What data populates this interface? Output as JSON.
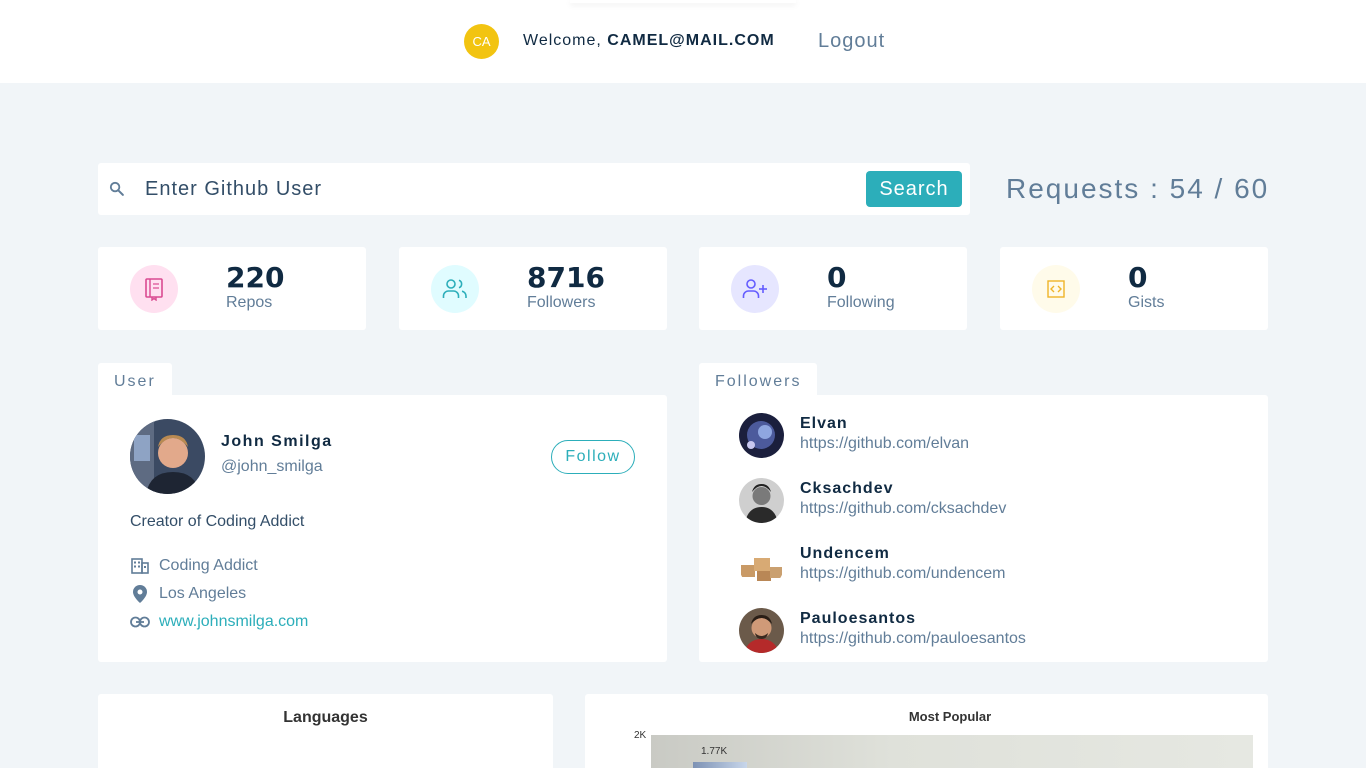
{
  "navbar": {
    "avatar_initials": "CA",
    "welcome_prefix": "Welcome,",
    "user_email": "CAMEL@MAIL.COM",
    "logout_label": "Logout",
    "avatar_color": "#f2c411"
  },
  "search": {
    "placeholder": "Enter Github User",
    "button_label": "Search",
    "requests_text": "Requests : 54 / 60"
  },
  "stats": [
    {
      "icon": "repo-book-icon",
      "value": "220",
      "label": "Repos",
      "color": "#da4a91",
      "bg": "#ffe0f0"
    },
    {
      "icon": "users-icon",
      "value": "8716",
      "label": "Followers",
      "color": "#2caeba",
      "bg": "#e0fcff"
    },
    {
      "icon": "user-plus-icon",
      "value": "0",
      "label": "Following",
      "color": "#645cff",
      "bg": "#e6e6ff"
    },
    {
      "icon": "code-icon",
      "value": "0",
      "label": "Gists",
      "color": "#f0b429",
      "bg": "#fffbea"
    }
  ],
  "user_card": {
    "tab_label": "User",
    "name": "John Smilga",
    "handle": "@john_smilga",
    "follow_label": "Follow",
    "bio": "Creator of Coding Addict",
    "company": "Coding Addict",
    "location": "Los Angeles",
    "blog": "www.johnsmilga.com"
  },
  "followers_card": {
    "tab_label": "Followers",
    "items": [
      {
        "name": "Elvan",
        "url": "https://github.com/elvan"
      },
      {
        "name": "Cksachdev",
        "url": "https://github.com/cksachdev"
      },
      {
        "name": "Undencem",
        "url": "https://github.com/undencem"
      },
      {
        "name": "Pauloesantos",
        "url": "https://github.com/pauloesantos"
      }
    ]
  },
  "languages_card": {
    "title": "Languages"
  },
  "popular_card": {
    "title": "Most Popular",
    "y_tick_top": "2K",
    "first_bar_label": "1.77K"
  },
  "colors": {
    "accent": "#2caeba",
    "page_bg": "#f1f5f8",
    "text_dark": "#102a42",
    "text_muted": "#617d98"
  }
}
